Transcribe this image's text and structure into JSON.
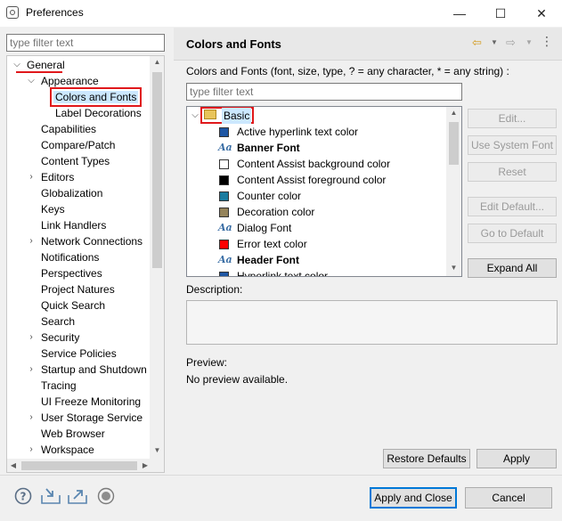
{
  "window": {
    "title": "Preferences",
    "minimize": "—",
    "maximize": "☐",
    "close": "✕"
  },
  "left": {
    "filter_placeholder": "type filter text",
    "tree": [
      {
        "label": "General",
        "expanded": true
      },
      {
        "label": "Appearance",
        "expanded": true
      },
      {
        "label": "Colors and Fonts",
        "selected": true
      },
      {
        "label": "Label Decorations"
      },
      {
        "label": "Capabilities"
      },
      {
        "label": "Compare/Patch"
      },
      {
        "label": "Content Types"
      },
      {
        "label": "Editors",
        "collapsed": true
      },
      {
        "label": "Globalization"
      },
      {
        "label": "Keys"
      },
      {
        "label": "Link Handlers"
      },
      {
        "label": "Network Connections",
        "collapsed": true
      },
      {
        "label": "Notifications"
      },
      {
        "label": "Perspectives"
      },
      {
        "label": "Project Natures"
      },
      {
        "label": "Quick Search"
      },
      {
        "label": "Search"
      },
      {
        "label": "Security",
        "collapsed": true
      },
      {
        "label": "Service Policies"
      },
      {
        "label": "Startup and Shutdown",
        "collapsed": true
      },
      {
        "label": "Tracing"
      },
      {
        "label": "UI Freeze Monitoring"
      },
      {
        "label": "User Storage Service",
        "collapsed": true
      },
      {
        "label": "Web Browser"
      },
      {
        "label": "Workspace",
        "collapsed": true
      }
    ]
  },
  "right": {
    "title": "Colors and Fonts",
    "description": "Colors and Fonts (font, size, type, ? = any character, * = any string) :",
    "filter_placeholder": "type filter text",
    "category": "Basic",
    "items": [
      {
        "label": "Active hyperlink text color",
        "kind": "color",
        "color": "#1f57a4"
      },
      {
        "label": "Banner Font",
        "kind": "font",
        "bold": true
      },
      {
        "label": "Content Assist background color",
        "kind": "color",
        "color": "#ffffff"
      },
      {
        "label": "Content Assist foreground color",
        "kind": "color",
        "color": "#000000"
      },
      {
        "label": "Counter color",
        "kind": "color",
        "color": "#1a7ca0"
      },
      {
        "label": "Decoration color",
        "kind": "color",
        "color": "#95845b"
      },
      {
        "label": "Dialog Font",
        "kind": "font",
        "bold": false
      },
      {
        "label": "Error text color",
        "kind": "color",
        "color": "#ff0000"
      },
      {
        "label": "Header Font",
        "kind": "font",
        "bold": true
      },
      {
        "label": "Hyperlink text color",
        "kind": "color",
        "color": "#1f57a4"
      }
    ],
    "buttons": {
      "edit": "Edit...",
      "use_system_font": "Use System Font",
      "reset": "Reset",
      "edit_default": "Edit Default...",
      "go_to_default": "Go to Default",
      "expand_all": "Expand All"
    },
    "description_label": "Description:",
    "preview_label": "Preview:",
    "preview_text": "No preview available.",
    "restore_defaults": "Restore Defaults",
    "apply": "Apply"
  },
  "footer": {
    "apply_close": "Apply and Close",
    "cancel": "Cancel",
    "icons": [
      "help-icon",
      "import-icon",
      "export-icon",
      "oomph-record-icon"
    ]
  },
  "colors": {
    "highlight": "#e0181b",
    "accent": "#0078d7",
    "selection": "#cce8ff"
  }
}
